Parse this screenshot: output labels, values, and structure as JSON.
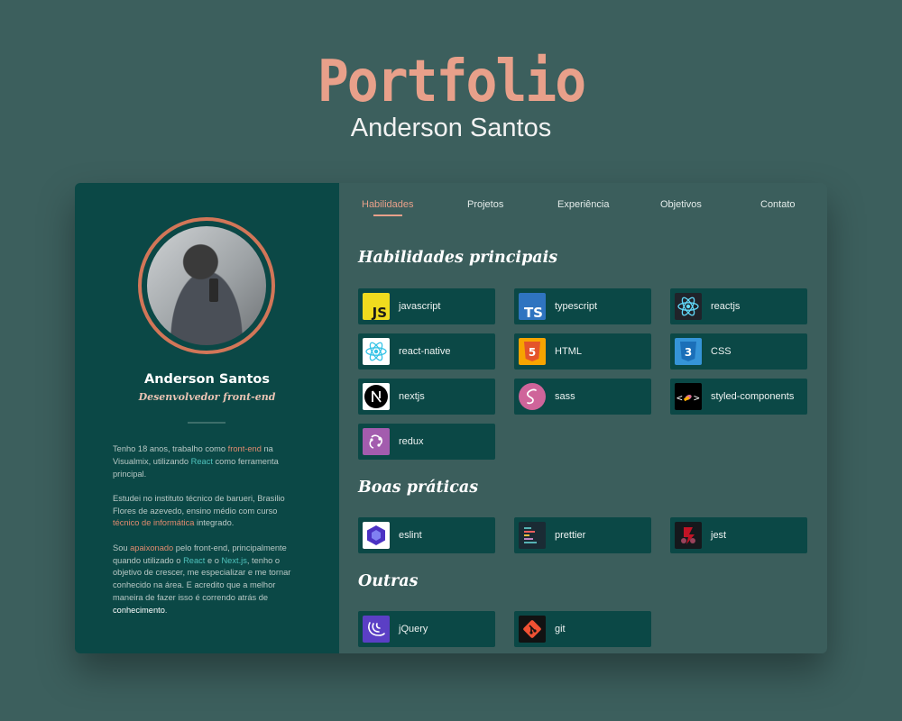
{
  "hero": {
    "title": "Portfolio",
    "subtitle": "Anderson Santos"
  },
  "sidebar": {
    "name": "Anderson Santos",
    "role": "Desenvolvedor front-end",
    "bio": {
      "p1": [
        "Tenho 18 anos, trabalho como ",
        "front-end",
        " na Visualmix, utilizando ",
        "React",
        " como ferramenta principal."
      ],
      "p2": [
        "Estudei no instituto técnico de barueri, Brasilio Flores de azevedo, ensino médio com curso ",
        "técnico de informática",
        " integrado."
      ],
      "p3": [
        "Sou ",
        "apaixonado",
        " pelo front-end, principalmente quando utilizado o ",
        "React",
        " e o ",
        "Next.js",
        ", tenho o objetivo de crescer, me especializar e me tornar conhecido na área. E acredito que a melhor maneira de fazer isso é correndo atrás de ",
        "conhecimento",
        "."
      ]
    }
  },
  "nav": {
    "items": [
      "Habilidades",
      "Projetos",
      "Experiência",
      "Objetivos",
      "Contato"
    ],
    "active": "Habilidades"
  },
  "sections": {
    "main_title": "Habilidades principais",
    "practices_title": "Boas práticas",
    "others_title": "Outras"
  },
  "skills": {
    "main": [
      {
        "label": "javascript",
        "icon": "javascript-icon",
        "bg": "#f0db1e"
      },
      {
        "label": "typescript",
        "icon": "typescript-icon",
        "bg": "#2f74c0"
      },
      {
        "label": "reactjs",
        "icon": "react-icon",
        "bg": "#20232a"
      },
      {
        "label": "react-native",
        "icon": "react-icon",
        "bg": "#ffffff"
      },
      {
        "label": "HTML",
        "icon": "html5-icon",
        "bg": "#f7a400"
      },
      {
        "label": "CSS",
        "icon": "css3-icon",
        "bg": "#3594d8"
      },
      {
        "label": "nextjs",
        "icon": "nextjs-icon",
        "bg": "#ffffff"
      },
      {
        "label": "sass",
        "icon": "sass-icon",
        "bg": "#cf649a"
      },
      {
        "label": "styled-components",
        "icon": "styled-components-icon",
        "bg": "#000000"
      },
      {
        "label": "redux",
        "icon": "redux-icon",
        "bg": "#a35cae"
      }
    ],
    "practices": [
      {
        "label": "eslint",
        "icon": "eslint-icon",
        "bg": "#ffffff"
      },
      {
        "label": "prettier",
        "icon": "prettier-icon",
        "bg": "#1a2b34"
      },
      {
        "label": "jest",
        "icon": "jest-icon",
        "bg": "#15181c"
      }
    ],
    "others": [
      {
        "label": "jQuery",
        "icon": "jquery-icon",
        "bg": "#5b3fc5"
      },
      {
        "label": "git",
        "icon": "git-icon",
        "bg": "#121212"
      }
    ]
  },
  "colors": {
    "background": "#3c5f5d",
    "sidebar": "#0b4846",
    "accent": "#e8a08a",
    "teal": "#4fc2bc"
  }
}
